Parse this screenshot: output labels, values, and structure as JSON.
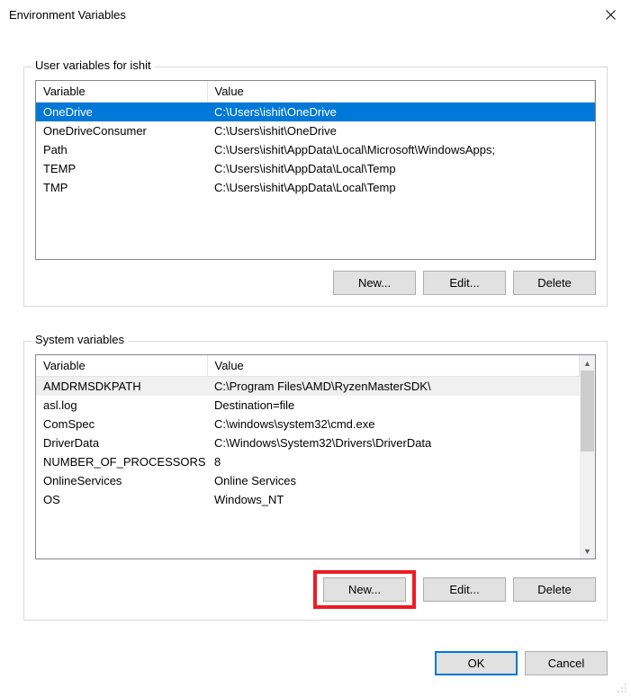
{
  "window": {
    "title": "Environment Variables"
  },
  "user_section": {
    "label": "User variables for ishit",
    "columns": {
      "variable": "Variable",
      "value": "Value"
    },
    "rows": [
      {
        "variable": "OneDrive",
        "value": "C:\\Users\\ishit\\OneDrive",
        "selected": true
      },
      {
        "variable": "OneDriveConsumer",
        "value": "C:\\Users\\ishit\\OneDrive"
      },
      {
        "variable": "Path",
        "value": "C:\\Users\\ishit\\AppData\\Local\\Microsoft\\WindowsApps;"
      },
      {
        "variable": "TEMP",
        "value": "C:\\Users\\ishit\\AppData\\Local\\Temp"
      },
      {
        "variable": "TMP",
        "value": "C:\\Users\\ishit\\AppData\\Local\\Temp"
      }
    ],
    "buttons": {
      "new": "New...",
      "edit": "Edit...",
      "delete": "Delete"
    }
  },
  "system_section": {
    "label": "System variables",
    "columns": {
      "variable": "Variable",
      "value": "Value"
    },
    "rows": [
      {
        "variable": "AMDRMSDKPATH",
        "value": "C:\\Program Files\\AMD\\RyzenMasterSDK\\",
        "highlight": true
      },
      {
        "variable": "asl.log",
        "value": "Destination=file"
      },
      {
        "variable": "ComSpec",
        "value": "C:\\windows\\system32\\cmd.exe"
      },
      {
        "variable": "DriverData",
        "value": "C:\\Windows\\System32\\Drivers\\DriverData"
      },
      {
        "variable": "NUMBER_OF_PROCESSORS",
        "value": "8"
      },
      {
        "variable": "OnlineServices",
        "value": "Online Services"
      },
      {
        "variable": "OS",
        "value": "Windows_NT"
      }
    ],
    "buttons": {
      "new": "New...",
      "edit": "Edit...",
      "delete": "Delete"
    }
  },
  "dialog_buttons": {
    "ok": "OK",
    "cancel": "Cancel"
  }
}
